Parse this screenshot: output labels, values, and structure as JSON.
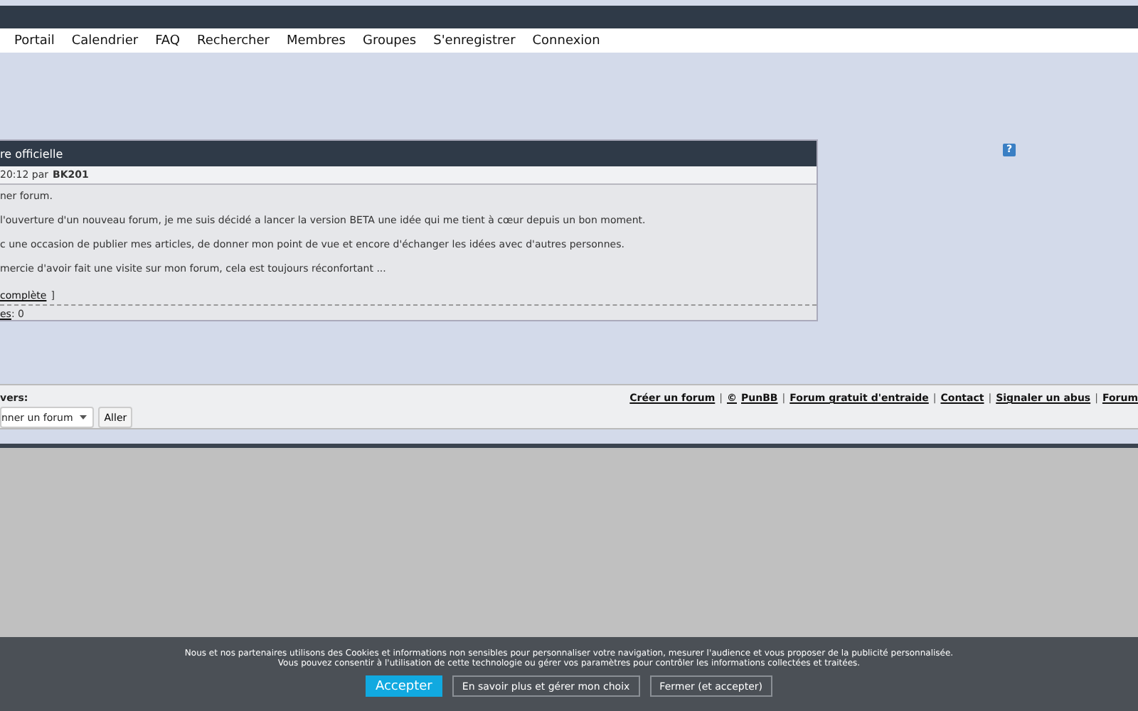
{
  "help": "?",
  "nav": [
    "Portail",
    "Calendrier",
    "FAQ",
    "Rechercher",
    "Membres",
    "Groupes",
    "S'enregistrer",
    "Connexion"
  ],
  "post": {
    "title": "re officielle",
    "meta": "20:12 par",
    "author": "BK201",
    "paragraphs": [
      "ner forum.",
      "l'ouverture d'un nouveau forum, je me suis décidé a lancer la version BETA une idée qui me tient à cœur depuis un bon moment.",
      "c une occasion de publier mes articles, de donner mon point de vue et encore d'échanger les idées avec d'autres personnes.",
      "mercie d'avoir fait une visite sur mon forum, cela est toujours réconfortant ..."
    ],
    "link": "complète",
    "link_close": "]",
    "comments_link": "es",
    "comments_count": ": 0"
  },
  "footer": {
    "label": "vers:",
    "select": "nner un forum",
    "go": "Aller",
    "links": [
      {
        "text": "Créer un forum",
        "sep": "|"
      },
      {
        "text": "© "
      },
      {
        "text": "PunBB",
        "sep": "|"
      },
      {
        "text": "Forum gratuit d'entraide",
        "sep": "|"
      },
      {
        "text": "Contact",
        "sep": "|"
      },
      {
        "text": "Signaler un abus",
        "sep": "|"
      },
      {
        "text": "Forum"
      }
    ]
  },
  "cookie": {
    "text": [
      "Nous et nos partenaires utilisons des Cookies et informations non sensibles pour personnaliser votre navigation, mesurer l'audience et vous proposer de la publicité personnalisée.",
      "Vous pouvez consentir à l'utilisation de cette technologie ou gérer vos paramètres pour contrôler les informations collectées et traitées."
    ],
    "buttons": [
      {
        "label": "Accepter",
        "kind": "primary"
      },
      {
        "label": "En savoir plus et gérer mon choix",
        "kind": "outline"
      },
      {
        "label": "Fermer (et accepter)",
        "kind": "outline"
      }
    ]
  }
}
